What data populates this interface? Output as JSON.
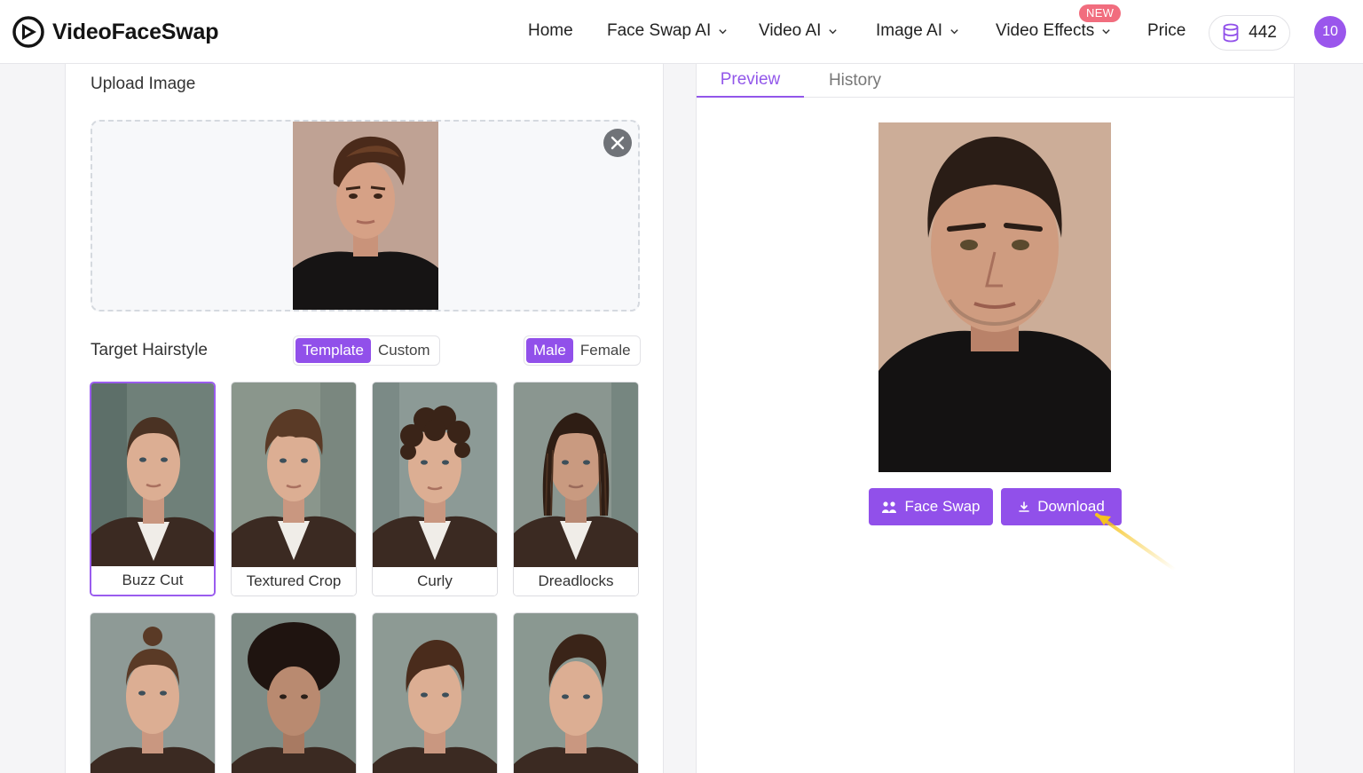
{
  "header": {
    "brand": "VideoFaceSwap",
    "nav": {
      "home": "Home",
      "face_swap_ai": "Face Swap AI",
      "video_ai": "Video AI",
      "image_ai": "Image AI",
      "video_effects": "Video Effects",
      "price": "Price"
    },
    "new_badge": "NEW",
    "credits": "442",
    "avatar_initials": "10"
  },
  "left": {
    "upload_title": "Upload Image",
    "target_title": "Target Hairstyle",
    "mode_toggle": {
      "template": "Template",
      "custom": "Custom",
      "selected": "Template"
    },
    "gender_toggle": {
      "male": "Male",
      "female": "Female",
      "selected": "Male"
    },
    "hairstyles": [
      {
        "label": "Buzz Cut",
        "selected": true
      },
      {
        "label": "Textured Crop",
        "selected": false
      },
      {
        "label": "Curly",
        "selected": false
      },
      {
        "label": "Dreadlocks",
        "selected": false
      }
    ]
  },
  "right": {
    "tabs": {
      "preview": "Preview",
      "history": "History",
      "active": "Preview"
    },
    "buttons": {
      "face_swap": "Face Swap",
      "download": "Download"
    }
  },
  "colors": {
    "accent": "#9150ea",
    "new_badge": "#f16d7e",
    "annotation_arrow": "#f6c31c"
  }
}
